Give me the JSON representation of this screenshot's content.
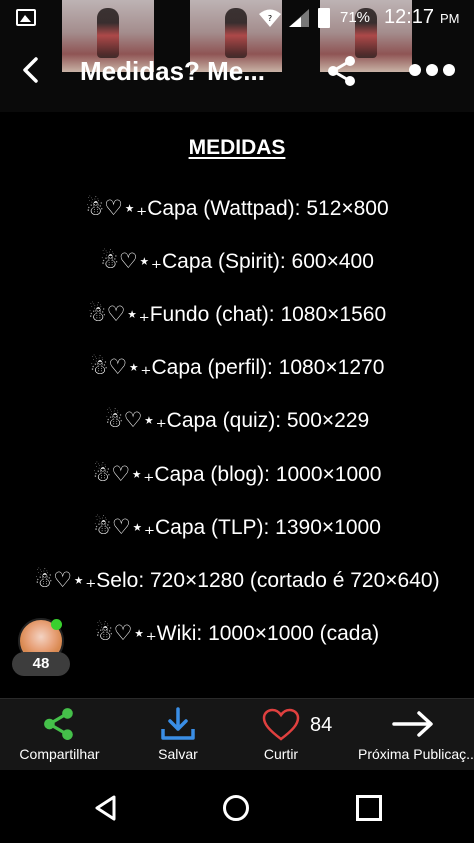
{
  "status_bar": {
    "battery": "71%",
    "time": "12:17",
    "ampm": "PM"
  },
  "header": {
    "title": "Medidas? Me..."
  },
  "post": {
    "heading": "MEDIDAS",
    "lines": [
      "☃♡⋆₊Capa (Wattpad): 512×800",
      "☃♡⋆₊Capa (Spirit): 600×400",
      "☃♡⋆₊Fundo (chat): 1080×1560",
      "☃♡⋆₊Capa (perfil): 1080×1270",
      "☃♡⋆₊Capa (quiz): 500×229",
      "☃♡⋆₊Capa (blog): 1000×1000",
      "☃♡⋆₊Capa (TLP): 1390×1000",
      "☃♡⋆₊Selo: 720×1280 (cortado é 720×640)",
      "☃♡⋆₊Wiki: 1000×1000 (cada)"
    ]
  },
  "author": {
    "badge_count": "48"
  },
  "actions": {
    "share_label": "Compartilhar",
    "save_label": "Salvar",
    "like_label": "Curtir",
    "like_count": "84",
    "next_label": "Próxima Publicaç..."
  },
  "icons": {
    "share": "share-icon",
    "save": "download-icon",
    "like": "heart-icon",
    "next": "arrow-right-icon"
  },
  "colors": {
    "share_green": "#45c04a",
    "save_blue": "#3a8ee6",
    "heart_red": "#e0403f",
    "online_green": "#39d02e"
  }
}
